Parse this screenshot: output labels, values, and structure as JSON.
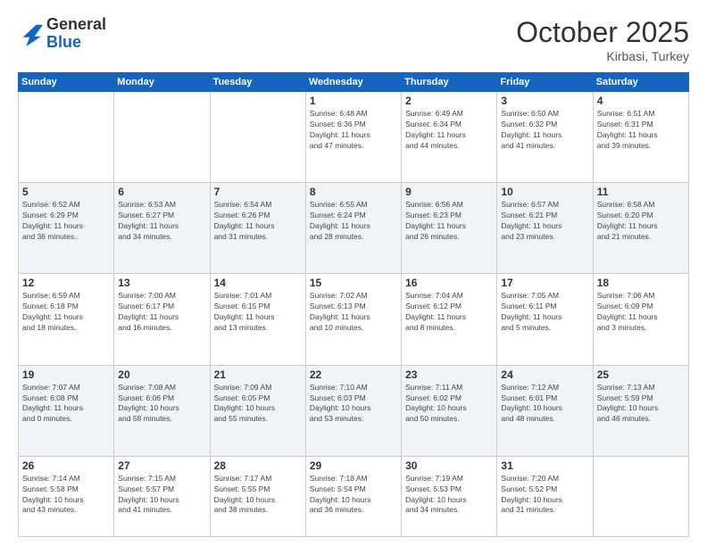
{
  "header": {
    "logo_general": "General",
    "logo_blue": "Blue",
    "month": "October 2025",
    "location": "Kirbasi, Turkey"
  },
  "days_of_week": [
    "Sunday",
    "Monday",
    "Tuesday",
    "Wednesday",
    "Thursday",
    "Friday",
    "Saturday"
  ],
  "weeks": [
    [
      {
        "day": "",
        "info": ""
      },
      {
        "day": "",
        "info": ""
      },
      {
        "day": "",
        "info": ""
      },
      {
        "day": "1",
        "info": "Sunrise: 6:48 AM\nSunset: 6:36 PM\nDaylight: 11 hours\nand 47 minutes."
      },
      {
        "day": "2",
        "info": "Sunrise: 6:49 AM\nSunset: 6:34 PM\nDaylight: 11 hours\nand 44 minutes."
      },
      {
        "day": "3",
        "info": "Sunrise: 6:50 AM\nSunset: 6:32 PM\nDaylight: 11 hours\nand 41 minutes."
      },
      {
        "day": "4",
        "info": "Sunrise: 6:51 AM\nSunset: 6:31 PM\nDaylight: 11 hours\nand 39 minutes."
      }
    ],
    [
      {
        "day": "5",
        "info": "Sunrise: 6:52 AM\nSunset: 6:29 PM\nDaylight: 11 hours\nand 36 minutes."
      },
      {
        "day": "6",
        "info": "Sunrise: 6:53 AM\nSunset: 6:27 PM\nDaylight: 11 hours\nand 34 minutes."
      },
      {
        "day": "7",
        "info": "Sunrise: 6:54 AM\nSunset: 6:26 PM\nDaylight: 11 hours\nand 31 minutes."
      },
      {
        "day": "8",
        "info": "Sunrise: 6:55 AM\nSunset: 6:24 PM\nDaylight: 11 hours\nand 28 minutes."
      },
      {
        "day": "9",
        "info": "Sunrise: 6:56 AM\nSunset: 6:23 PM\nDaylight: 11 hours\nand 26 minutes."
      },
      {
        "day": "10",
        "info": "Sunrise: 6:57 AM\nSunset: 6:21 PM\nDaylight: 11 hours\nand 23 minutes."
      },
      {
        "day": "11",
        "info": "Sunrise: 6:58 AM\nSunset: 6:20 PM\nDaylight: 11 hours\nand 21 minutes."
      }
    ],
    [
      {
        "day": "12",
        "info": "Sunrise: 6:59 AM\nSunset: 6:18 PM\nDaylight: 11 hours\nand 18 minutes."
      },
      {
        "day": "13",
        "info": "Sunrise: 7:00 AM\nSunset: 6:17 PM\nDaylight: 11 hours\nand 16 minutes."
      },
      {
        "day": "14",
        "info": "Sunrise: 7:01 AM\nSunset: 6:15 PM\nDaylight: 11 hours\nand 13 minutes."
      },
      {
        "day": "15",
        "info": "Sunrise: 7:02 AM\nSunset: 6:13 PM\nDaylight: 11 hours\nand 10 minutes."
      },
      {
        "day": "16",
        "info": "Sunrise: 7:04 AM\nSunset: 6:12 PM\nDaylight: 11 hours\nand 8 minutes."
      },
      {
        "day": "17",
        "info": "Sunrise: 7:05 AM\nSunset: 6:11 PM\nDaylight: 11 hours\nand 5 minutes."
      },
      {
        "day": "18",
        "info": "Sunrise: 7:06 AM\nSunset: 6:09 PM\nDaylight: 11 hours\nand 3 minutes."
      }
    ],
    [
      {
        "day": "19",
        "info": "Sunrise: 7:07 AM\nSunset: 6:08 PM\nDaylight: 11 hours\nand 0 minutes."
      },
      {
        "day": "20",
        "info": "Sunrise: 7:08 AM\nSunset: 6:06 PM\nDaylight: 10 hours\nand 58 minutes."
      },
      {
        "day": "21",
        "info": "Sunrise: 7:09 AM\nSunset: 6:05 PM\nDaylight: 10 hours\nand 55 minutes."
      },
      {
        "day": "22",
        "info": "Sunrise: 7:10 AM\nSunset: 6:03 PM\nDaylight: 10 hours\nand 53 minutes."
      },
      {
        "day": "23",
        "info": "Sunrise: 7:11 AM\nSunset: 6:02 PM\nDaylight: 10 hours\nand 50 minutes."
      },
      {
        "day": "24",
        "info": "Sunrise: 7:12 AM\nSunset: 6:01 PM\nDaylight: 10 hours\nand 48 minutes."
      },
      {
        "day": "25",
        "info": "Sunrise: 7:13 AM\nSunset: 5:59 PM\nDaylight: 10 hours\nand 46 minutes."
      }
    ],
    [
      {
        "day": "26",
        "info": "Sunrise: 7:14 AM\nSunset: 5:58 PM\nDaylight: 10 hours\nand 43 minutes."
      },
      {
        "day": "27",
        "info": "Sunrise: 7:15 AM\nSunset: 5:57 PM\nDaylight: 10 hours\nand 41 minutes."
      },
      {
        "day": "28",
        "info": "Sunrise: 7:17 AM\nSunset: 5:55 PM\nDaylight: 10 hours\nand 38 minutes."
      },
      {
        "day": "29",
        "info": "Sunrise: 7:18 AM\nSunset: 5:54 PM\nDaylight: 10 hours\nand 36 minutes."
      },
      {
        "day": "30",
        "info": "Sunrise: 7:19 AM\nSunset: 5:53 PM\nDaylight: 10 hours\nand 34 minutes."
      },
      {
        "day": "31",
        "info": "Sunrise: 7:20 AM\nSunset: 5:52 PM\nDaylight: 10 hours\nand 31 minutes."
      },
      {
        "day": "",
        "info": ""
      }
    ]
  ]
}
